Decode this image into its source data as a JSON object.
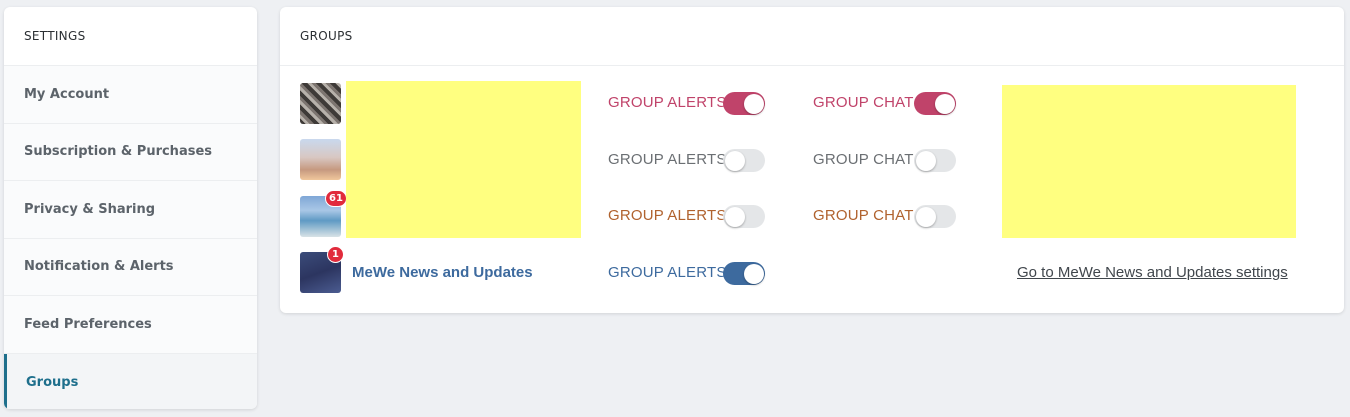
{
  "sidebar": {
    "title": "SETTINGS",
    "items": [
      {
        "label": "My Account"
      },
      {
        "label": "Subscription & Purchases"
      },
      {
        "label": "Privacy & Sharing"
      },
      {
        "label": "Notification & Alerts"
      },
      {
        "label": "Feed Preferences"
      },
      {
        "label": "Groups",
        "active": true
      }
    ]
  },
  "groups": {
    "title": "GROUPS",
    "alerts_label": "GROUP ALERTS",
    "chat_label": "GROUP CHAT",
    "rows": [
      {
        "alerts_on": true,
        "chat_on": true,
        "label_color": "#c0436a",
        "toggle_color": "#c0436a"
      },
      {
        "alerts_on": false,
        "chat_on": false,
        "label_color": "#6b6f73"
      },
      {
        "badge": "61",
        "alerts_on": false,
        "chat_on": false,
        "label_color": "#b0622e"
      },
      {
        "badge": "1",
        "name": "MeWe News and Updates",
        "alerts_on": true,
        "label_color": "#3d6a9e",
        "toggle_color": "#3d6a9e"
      }
    ],
    "settings_link": "Go to MeWe News and Updates settings"
  },
  "colors": {
    "redacted": "#ffff80",
    "accent_teal": "#1e6f8c",
    "badge_red": "#e12b3c"
  }
}
